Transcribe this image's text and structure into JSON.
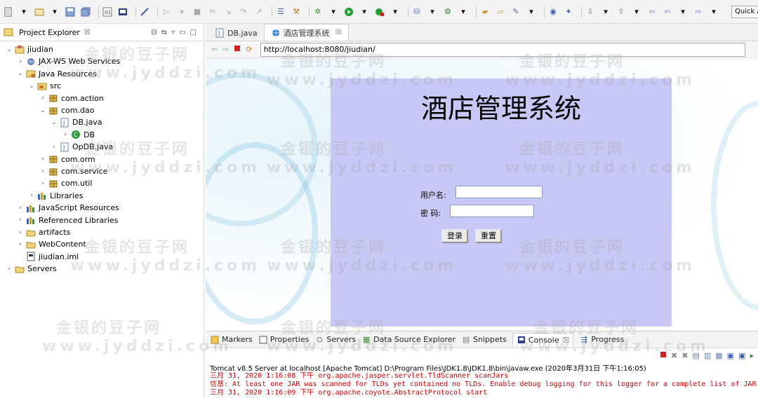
{
  "toolbar": {
    "quick_access": "Quick Access"
  },
  "explorer": {
    "title": "Project Explorer",
    "tree": [
      {
        "label": "jiudian",
        "level": 0,
        "twisty": "v",
        "icon": "project-icon"
      },
      {
        "label": "JAX-WS Web Services",
        "level": 1,
        "twisty": ">",
        "icon": "webservice-icon"
      },
      {
        "label": "Java Resources",
        "level": 1,
        "twisty": "v",
        "icon": "java-resources-icon"
      },
      {
        "label": "src",
        "level": 2,
        "twisty": "v",
        "icon": "source-folder-icon"
      },
      {
        "label": "com.action",
        "level": 3,
        "twisty": ">",
        "icon": "package-icon"
      },
      {
        "label": "com.dao",
        "level": 3,
        "twisty": "v",
        "icon": "package-icon"
      },
      {
        "label": "DB.java",
        "level": 4,
        "twisty": "v",
        "icon": "java-file-icon"
      },
      {
        "label": "DB",
        "level": 5,
        "twisty": ">",
        "icon": "class-icon"
      },
      {
        "label": "OpDB.java",
        "level": 4,
        "twisty": ">",
        "icon": "java-file-icon"
      },
      {
        "label": "com.orm",
        "level": 3,
        "twisty": ">",
        "icon": "package-icon"
      },
      {
        "label": "com.service",
        "level": 3,
        "twisty": ">",
        "icon": "package-icon"
      },
      {
        "label": "com.util",
        "level": 3,
        "twisty": ">",
        "icon": "package-icon"
      },
      {
        "label": "Libraries",
        "level": 2,
        "twisty": ">",
        "icon": "library-icon"
      },
      {
        "label": "JavaScript Resources",
        "level": 1,
        "twisty": ">",
        "icon": "library-icon"
      },
      {
        "label": "Referenced Libraries",
        "level": 1,
        "twisty": ">",
        "icon": "library-icon"
      },
      {
        "label": "artifacts",
        "level": 1,
        "twisty": ">",
        "icon": "folder-icon"
      },
      {
        "label": "WebContent",
        "level": 1,
        "twisty": ">",
        "icon": "folder-icon"
      },
      {
        "label": "jiudian.iml",
        "level": 1,
        "twisty": "",
        "icon": "file-icon"
      },
      {
        "label": "Servers",
        "level": 0,
        "twisty": ">",
        "icon": "folder-icon"
      }
    ]
  },
  "editor": {
    "tabs": [
      {
        "label": "DB.java",
        "active": false
      },
      {
        "label": "酒店管理系统",
        "active": true
      }
    ],
    "url": "http://localhost:8080/jiudian/"
  },
  "login": {
    "title": "酒店管理系统",
    "username_label": "用户名:",
    "password_label": "密 码:",
    "login_button": "登录",
    "reset_button": "重置"
  },
  "console": {
    "tabs": [
      "Markers",
      "Properties",
      "Servers",
      "Data Source Explorer",
      "Snippets",
      "Console",
      "Progress"
    ],
    "description": "Tomcat v8.5 Server at localhost [Apache Tomcat] D:\\Program Files\\JDK1.8\\JDK1.8\\bin\\javaw.exe (2020年3月31日 下午1:16:05)",
    "log": [
      "三月 31, 2020 1:16:08 下午 org.apache.jasper.servlet.TldScanner scanJars",
      "信息: At least one JAR was scanned for TLDs yet contained no TLDs. Enable debug logging for this logger for a complete list of JAR",
      "三月 31, 2020 1:16:09 下午 org.apache.coyote.AbstractProtocol start"
    ]
  },
  "watermark": {
    "cn": "金银的豆子网",
    "en": "www.jyddzi.com"
  },
  "colors": {
    "login_panel": "#c8c8f7",
    "log_error": "#d00000",
    "run_green": "#1e9e2b",
    "stop_red": "#d32020"
  }
}
